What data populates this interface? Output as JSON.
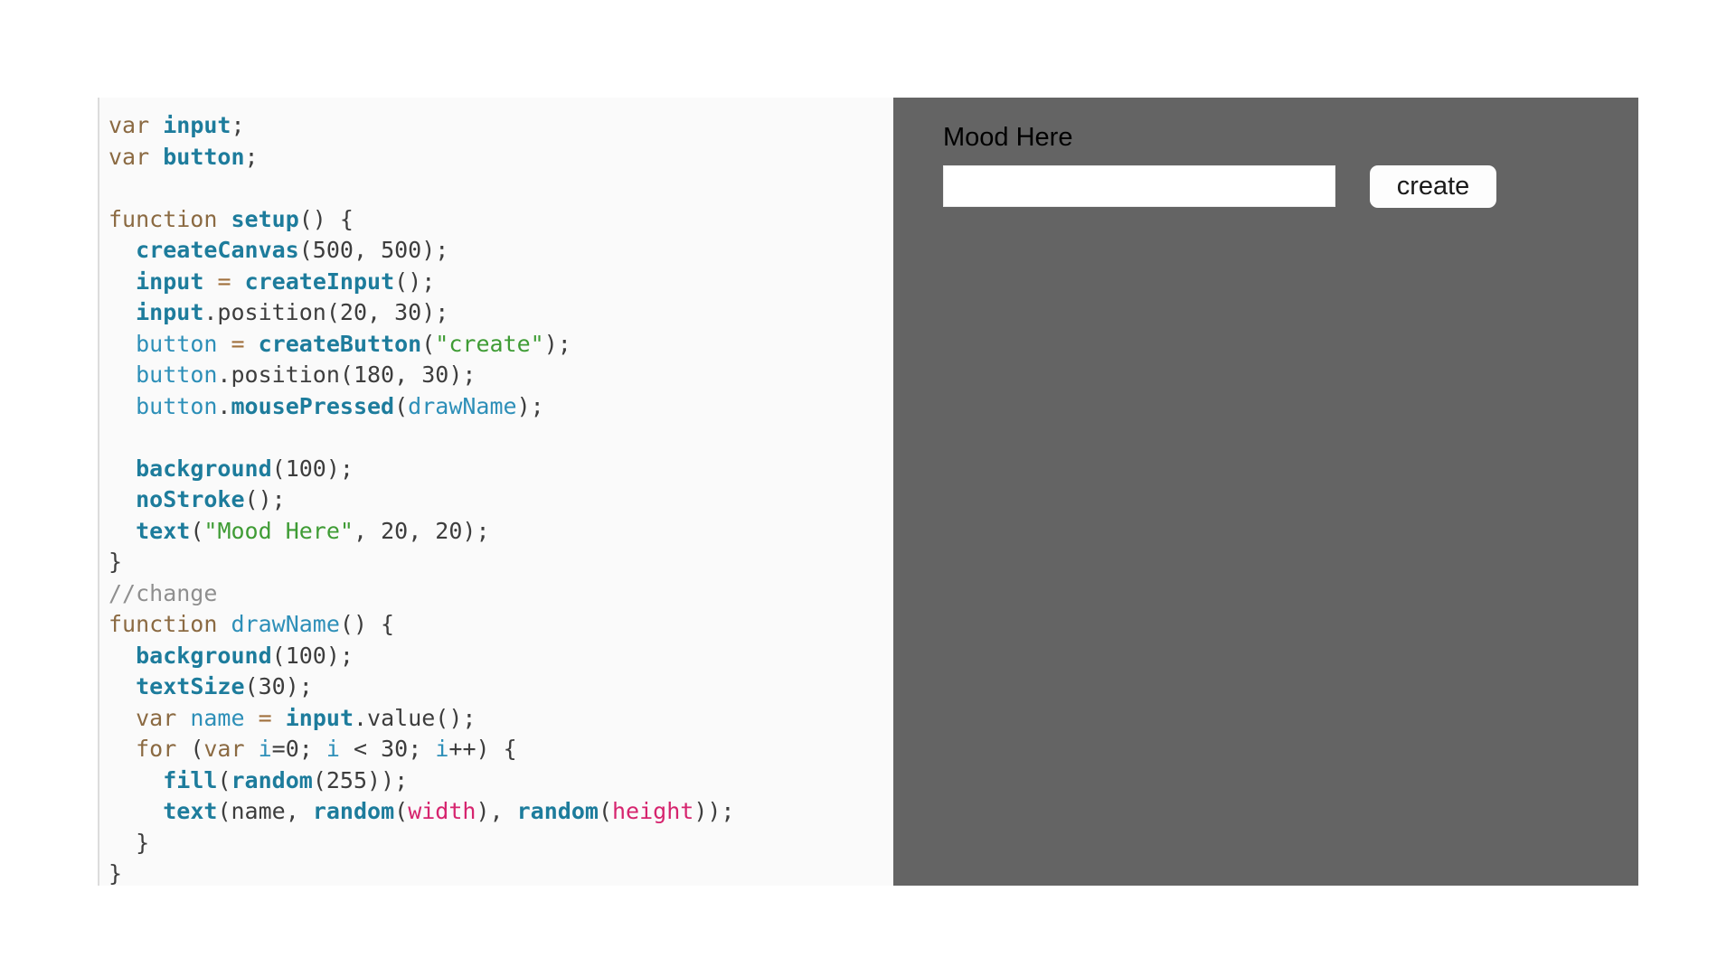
{
  "editor": {
    "language": "javascript",
    "background_color": "#fafafa",
    "code_lines": [
      [
        {
          "t": "kw",
          "s": "var"
        },
        {
          "t": "punc",
          "s": " "
        },
        {
          "t": "var-b",
          "s": "input"
        },
        {
          "t": "punc",
          "s": ";"
        }
      ],
      [
        {
          "t": "kw",
          "s": "var"
        },
        {
          "t": "punc",
          "s": " "
        },
        {
          "t": "var-b",
          "s": "button"
        },
        {
          "t": "punc",
          "s": ";"
        }
      ],
      [],
      [
        {
          "t": "kw",
          "s": "function"
        },
        {
          "t": "punc",
          "s": " "
        },
        {
          "t": "fn-b",
          "s": "setup"
        },
        {
          "t": "punc",
          "s": "() {"
        }
      ],
      [
        {
          "t": "punc",
          "s": "  "
        },
        {
          "t": "fn-b",
          "s": "createCanvas"
        },
        {
          "t": "punc",
          "s": "("
        },
        {
          "t": "num",
          "s": "500"
        },
        {
          "t": "punc",
          "s": ", "
        },
        {
          "t": "num",
          "s": "500"
        },
        {
          "t": "punc",
          "s": ");"
        }
      ],
      [
        {
          "t": "punc",
          "s": "  "
        },
        {
          "t": "var-b",
          "s": "input"
        },
        {
          "t": "punc",
          "s": " "
        },
        {
          "t": "op",
          "s": "="
        },
        {
          "t": "punc",
          "s": " "
        },
        {
          "t": "fn-b",
          "s": "createInput"
        },
        {
          "t": "punc",
          "s": "();"
        }
      ],
      [
        {
          "t": "punc",
          "s": "  "
        },
        {
          "t": "var-b",
          "s": "input"
        },
        {
          "t": "punc",
          "s": ".position("
        },
        {
          "t": "num",
          "s": "20"
        },
        {
          "t": "punc",
          "s": ", "
        },
        {
          "t": "num",
          "s": "30"
        },
        {
          "t": "punc",
          "s": ");"
        }
      ],
      [
        {
          "t": "punc",
          "s": "  "
        },
        {
          "t": "var",
          "s": "button"
        },
        {
          "t": "punc",
          "s": " "
        },
        {
          "t": "op",
          "s": "="
        },
        {
          "t": "punc",
          "s": " "
        },
        {
          "t": "fn-b",
          "s": "createButton"
        },
        {
          "t": "punc",
          "s": "("
        },
        {
          "t": "str",
          "s": "\"create\""
        },
        {
          "t": "punc",
          "s": ");"
        }
      ],
      [
        {
          "t": "punc",
          "s": "  "
        },
        {
          "t": "var",
          "s": "button"
        },
        {
          "t": "punc",
          "s": ".position("
        },
        {
          "t": "num",
          "s": "180"
        },
        {
          "t": "punc",
          "s": ", "
        },
        {
          "t": "num",
          "s": "30"
        },
        {
          "t": "punc",
          "s": ");"
        }
      ],
      [
        {
          "t": "punc",
          "s": "  "
        },
        {
          "t": "var",
          "s": "button"
        },
        {
          "t": "punc",
          "s": "."
        },
        {
          "t": "fn-b",
          "s": "mousePressed"
        },
        {
          "t": "punc",
          "s": "("
        },
        {
          "t": "fn",
          "s": "drawName"
        },
        {
          "t": "punc",
          "s": ");"
        }
      ],
      [],
      [
        {
          "t": "punc",
          "s": "  "
        },
        {
          "t": "fn-b",
          "s": "background"
        },
        {
          "t": "punc",
          "s": "("
        },
        {
          "t": "num",
          "s": "100"
        },
        {
          "t": "punc",
          "s": ");"
        }
      ],
      [
        {
          "t": "punc",
          "s": "  "
        },
        {
          "t": "fn-b",
          "s": "noStroke"
        },
        {
          "t": "punc",
          "s": "();"
        }
      ],
      [
        {
          "t": "punc",
          "s": "  "
        },
        {
          "t": "fn-b",
          "s": "text"
        },
        {
          "t": "punc",
          "s": "("
        },
        {
          "t": "str",
          "s": "\"Mood Here\""
        },
        {
          "t": "punc",
          "s": ", "
        },
        {
          "t": "num",
          "s": "20"
        },
        {
          "t": "punc",
          "s": ", "
        },
        {
          "t": "num",
          "s": "20"
        },
        {
          "t": "punc",
          "s": ");"
        }
      ],
      [
        {
          "t": "punc",
          "s": "}"
        }
      ],
      [
        {
          "t": "com",
          "s": "//change"
        }
      ],
      [
        {
          "t": "kw",
          "s": "function"
        },
        {
          "t": "punc",
          "s": " "
        },
        {
          "t": "fn",
          "s": "drawName"
        },
        {
          "t": "punc",
          "s": "() {"
        }
      ],
      [
        {
          "t": "punc",
          "s": "  "
        },
        {
          "t": "fn-b",
          "s": "background"
        },
        {
          "t": "punc",
          "s": "("
        },
        {
          "t": "num",
          "s": "100"
        },
        {
          "t": "punc",
          "s": ");"
        }
      ],
      [
        {
          "t": "punc",
          "s": "  "
        },
        {
          "t": "fn-b",
          "s": "textSize"
        },
        {
          "t": "punc",
          "s": "("
        },
        {
          "t": "num",
          "s": "30"
        },
        {
          "t": "punc",
          "s": ");"
        }
      ],
      [
        {
          "t": "punc",
          "s": "  "
        },
        {
          "t": "kw",
          "s": "var"
        },
        {
          "t": "punc",
          "s": " "
        },
        {
          "t": "var",
          "s": "name"
        },
        {
          "t": "punc",
          "s": " "
        },
        {
          "t": "op",
          "s": "="
        },
        {
          "t": "punc",
          "s": " "
        },
        {
          "t": "var-b",
          "s": "input"
        },
        {
          "t": "punc",
          "s": ".value();"
        }
      ],
      [
        {
          "t": "punc",
          "s": "  "
        },
        {
          "t": "kw",
          "s": "for"
        },
        {
          "t": "punc",
          "s": " ("
        },
        {
          "t": "kw",
          "s": "var"
        },
        {
          "t": "punc",
          "s": " "
        },
        {
          "t": "var",
          "s": "i"
        },
        {
          "t": "punc",
          "s": "="
        },
        {
          "t": "num",
          "s": "0"
        },
        {
          "t": "punc",
          "s": "; "
        },
        {
          "t": "var",
          "s": "i"
        },
        {
          "t": "punc",
          "s": " < "
        },
        {
          "t": "num",
          "s": "30"
        },
        {
          "t": "punc",
          "s": "; "
        },
        {
          "t": "var",
          "s": "i"
        },
        {
          "t": "punc",
          "s": "++) {"
        }
      ],
      [
        {
          "t": "punc",
          "s": "    "
        },
        {
          "t": "fn-b",
          "s": "fill"
        },
        {
          "t": "punc",
          "s": "("
        },
        {
          "t": "fn-b",
          "s": "random"
        },
        {
          "t": "punc",
          "s": "("
        },
        {
          "t": "num",
          "s": "255"
        },
        {
          "t": "punc",
          "s": "));"
        }
      ],
      [
        {
          "t": "punc",
          "s": "    "
        },
        {
          "t": "fn-b",
          "s": "text"
        },
        {
          "t": "punc",
          "s": "("
        },
        {
          "t": "num",
          "s": "name"
        },
        {
          "t": "punc",
          "s": ", "
        },
        {
          "t": "fn-b",
          "s": "random"
        },
        {
          "t": "punc",
          "s": "("
        },
        {
          "t": "const",
          "s": "width"
        },
        {
          "t": "punc",
          "s": "), "
        },
        {
          "t": "fn-b",
          "s": "random"
        },
        {
          "t": "punc",
          "s": "("
        },
        {
          "t": "const",
          "s": "height"
        },
        {
          "t": "punc",
          "s": "));"
        }
      ],
      [
        {
          "t": "punc",
          "s": "  }"
        }
      ],
      [
        {
          "t": "punc",
          "s": "}"
        }
      ]
    ],
    "colors": {
      "keyword": "#8b6a42",
      "builtin_function": "#1d7c9c",
      "identifier": "#2d8fb8",
      "string": "#3f9c35",
      "comment": "#8f8f8f",
      "operator": "#a0703c",
      "constant": "#d6246e",
      "punctuation": "#3d3d3d"
    }
  },
  "canvas": {
    "background_color": "#646464",
    "label": "Mood Here",
    "input": {
      "value": "",
      "placeholder": ""
    },
    "button": {
      "label": "create"
    }
  }
}
